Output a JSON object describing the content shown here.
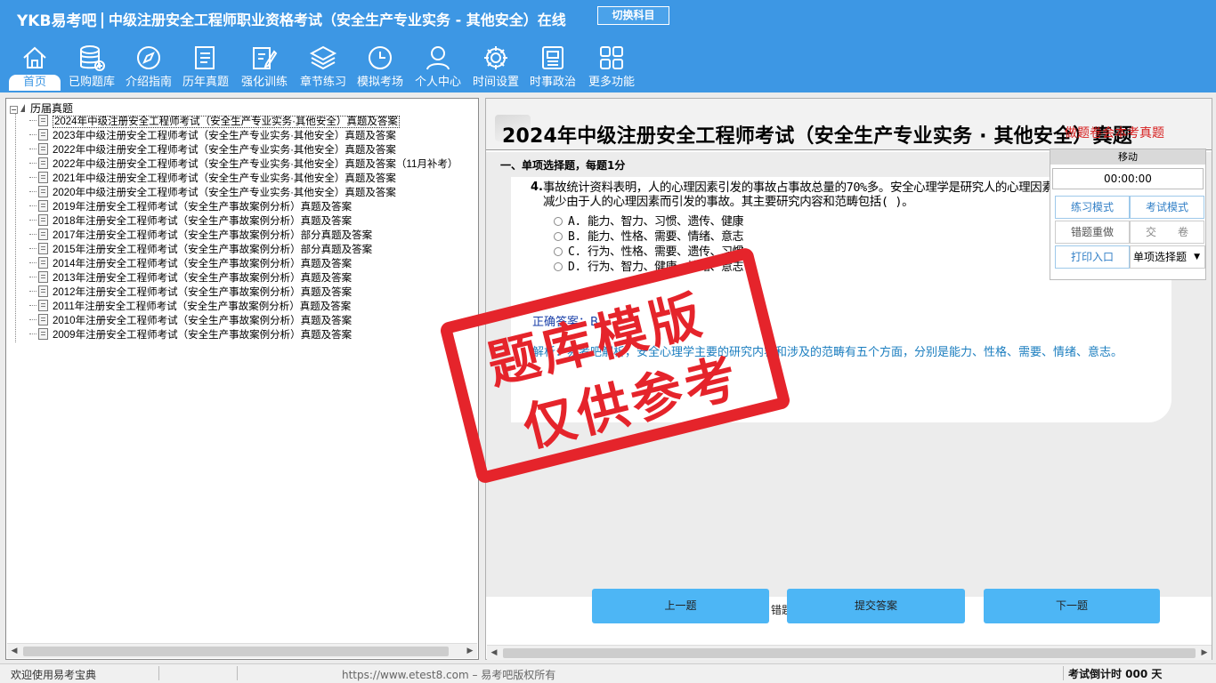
{
  "app": {
    "brand": "YKB易考吧",
    "title": "中级注册安全工程师职业资格考试（安全生产专业实务 - 其他安全）在线",
    "switch_button": "切换科目"
  },
  "nav": [
    {
      "label": "首页",
      "icon": "home-icon",
      "active": true
    },
    {
      "label": "已购题库",
      "icon": "database-icon"
    },
    {
      "label": "介绍指南",
      "icon": "compass-icon"
    },
    {
      "label": "历年真题",
      "icon": "list-doc-icon"
    },
    {
      "label": "强化训练",
      "icon": "edit-icon"
    },
    {
      "label": "章节练习",
      "icon": "layers-icon"
    },
    {
      "label": "模拟考场",
      "icon": "clock-icon"
    },
    {
      "label": "个人中心",
      "icon": "user-icon"
    },
    {
      "label": "时间设置",
      "icon": "gear-icon"
    },
    {
      "label": "时事政治",
      "icon": "news-icon"
    },
    {
      "label": "更多功能",
      "icon": "grid-icon"
    }
  ],
  "tree": {
    "root": "历届真题",
    "items": [
      "2024年中级注册安全工程师考试（安全生产专业实务·其他安全）真题及答案",
      "2023年中级注册安全工程师考试（安全生产专业实务·其他安全）真题及答案",
      "2022年中级注册安全工程师考试（安全生产专业实务·其他安全）真题及答案",
      "2022年中级注册安全工程师考试（安全生产专业实务·其他安全）真题及答案（11月补考）",
      "2021年中级注册安全工程师考试（安全生产专业实务·其他安全）真题及答案",
      "2020年中级注册安全工程师考试（安全生产专业实务·其他安全）真题及答案",
      "2019年注册安全工程师考试（安全生产事故案例分析）真题及答案",
      "2018年注册安全工程师考试（安全生产事故案例分析）真题及答案",
      "2017年注册安全工程师考试（安全生产事故案例分析）部分真题及答案",
      "2015年注册安全工程师考试（安全生产事故案例分析）部分真题及答案",
      "2014年注册安全工程师考试（安全生产事故案例分析）真题及答案",
      "2013年注册安全工程师考试（安全生产事故案例分析）真题及答案",
      "2012年注册安全工程师考试（安全生产事故案例分析）真题及答案",
      "2011年注册安全工程师考试（安全生产事故案例分析）真题及答案",
      "2010年注册安全工程师考试（安全生产事故案例分析）真题及答案",
      "2009年注册安全工程师考试（安全生产事故案例分析）真题及答案"
    ],
    "selected_index": 0
  },
  "exam": {
    "title": "2024年中级注册安全工程师考试（安全生产专业实务 · 其他安全）真题",
    "overlay_mark": "做题卷会本考真题",
    "section": "一、单项选择题，每题1分",
    "question_number": "4.",
    "question_text": "事故统计资料表明，人的心理因素引发的事故占事故总量的70%多。安全心理学是研究人的心理因素，减少由于人的心理因素而引发的事故。其主要研究内容和范畴包括( )。",
    "options": [
      "A. 能力、智力、习惯、遗传、健康",
      "B. 能力、性格、需要、情绪、意志",
      "C. 行为、性格、需要、遗传、习惯",
      "D. 行为、智力、健康、情绪、意志"
    ],
    "answer": "正确答案：B",
    "explanation": "解析：易考吧解析，安全心理学主要的研究内容和涉及的范畴有五个方面，分别是能力、性格、需要、情绪、意志。"
  },
  "controls": {
    "move": "移动",
    "timer": "00:00:00",
    "practice_mode": "练习模式",
    "exam_mode": "考试模式",
    "redo_wrong": "错题重做",
    "submit_paper": "交　　卷",
    "print": "打印入口",
    "question_type": "单项选择题"
  },
  "buttons": {
    "prev": "上一题",
    "error_label": "错题",
    "submit": "提交答案",
    "next": "下一题"
  },
  "stamp": {
    "line1": "题库模版",
    "line2": "仅供参考"
  },
  "status": {
    "welcome": "欢迎使用易考宝典",
    "copyright": "https://www.etest8.com – 易考吧版权所有",
    "countdown": "考试倒计时 000 天"
  }
}
